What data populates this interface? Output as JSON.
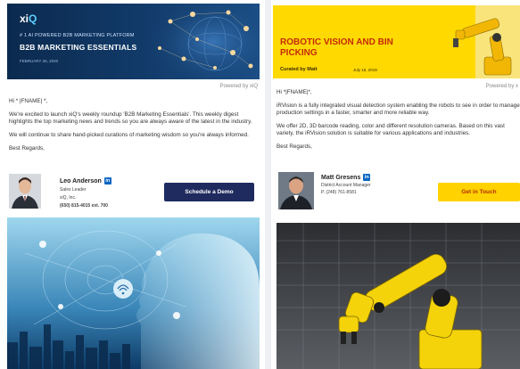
{
  "left": {
    "banner": {
      "logo_prefix": "xi",
      "logo_suffix": "Q",
      "tagline": "# 1 AI POWERED B2B MARKETING PLATFORM",
      "title": "B2B MARKETING ESSENTIALS",
      "date": "FEBRUARY 26, 2020"
    },
    "powered_by": "Powered by xiQ",
    "greeting": "Hi * |FNAME| *,",
    "paragraph1": "We're excited to launch xiQ's weekly roundup 'B2B Marketing Essentials'. This weekly digest highlights the top marketing news and trends so you are always aware of the latest in the industry.",
    "paragraph2": "We will continue to share hand-picked curations of marketing wisdom so you're always informed.",
    "closing": "Best Regards,",
    "signature": {
      "name": "Leo Anderson",
      "role": "Sales Leader",
      "company": "xiQ, Inc.",
      "phone": "(650) 815-4015 ext. 700",
      "linkedin": "in"
    },
    "cta": "Schedule a Demo"
  },
  "right": {
    "banner": {
      "title": "ROBOTIC VISION AND BIN PICKING",
      "curator": "Curated by Matt",
      "date": "July 15, 2019"
    },
    "powered_by": "Powered by x",
    "greeting": "Hi *|FNAME|*,",
    "paragraph1": "iRVision is a fully integrated visual detection system enabling the robots to see in order to manage production settings in a faster, smarter and more reliable way.",
    "paragraph2": "We offer 2D, 3D barcode reading, color and different resolution cameras. Based on this vast variety, the iRVision solution is suitable for various applications and industries.",
    "closing": "Best Regards,",
    "signature": {
      "name": "Matt Gresens",
      "role": "District Account Manager",
      "phone": "P. (248) 761-8581",
      "linkedin": "in"
    },
    "cta": "Get in Touch"
  },
  "colors": {
    "left_banner": "#0b2a4f",
    "left_cta": "#1f2a5e",
    "right_banner": "#ffd900",
    "right_title": "#c42c0a",
    "linkedin": "#0a66c2"
  }
}
